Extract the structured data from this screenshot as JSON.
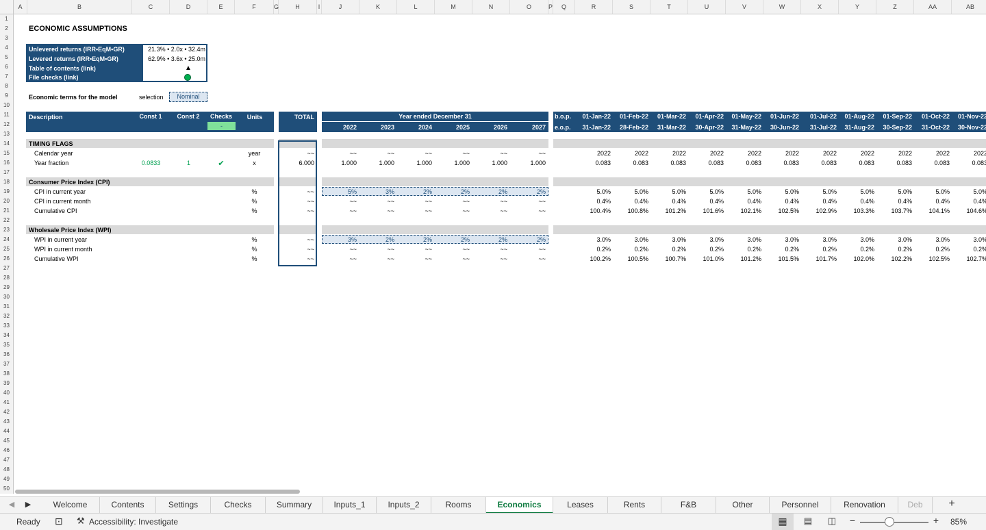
{
  "columns": [
    "A",
    "B",
    "C",
    "D",
    "E",
    "F",
    "G",
    "H",
    "I",
    "J",
    "K",
    "L",
    "M",
    "N",
    "O",
    "P",
    "Q",
    "R",
    "S",
    "T",
    "U",
    "V",
    "W",
    "X",
    "Y",
    "Z",
    "AA",
    "AB"
  ],
  "rows": [
    "1",
    "2",
    "3",
    "4",
    "5",
    "6",
    "7",
    "8",
    "9",
    "10",
    "11",
    "12",
    "13",
    "14",
    "15",
    "16",
    "17",
    "18",
    "19",
    "20",
    "21",
    "22",
    "23",
    "24",
    "25",
    "26",
    "27",
    "28",
    "29",
    "30",
    "31",
    "32",
    "33",
    "34",
    "35",
    "36",
    "37",
    "38",
    "39",
    "40",
    "41",
    "42",
    "43",
    "44",
    "45",
    "46",
    "47",
    "48",
    "49",
    "50"
  ],
  "sheet": {
    "title": "ECONOMIC ASSUMPTIONS",
    "summary": [
      {
        "label": "Unlevered returns (IRR•EqM•GR)",
        "value": "21.3% • 2.0x • 32.4m"
      },
      {
        "label": "Levered returns (IRR•EqM•GR)",
        "value": "62.9% • 3.6x • 25.0m"
      },
      {
        "label": "Table of contents (link)",
        "value": "▲"
      },
      {
        "label": "File checks (link)",
        "value": ""
      }
    ],
    "terms_label": "Economic terms for the model",
    "selection_label": "selection",
    "selection_value": "Nominal",
    "header": {
      "description": "Description",
      "const1": "Const 1",
      "const2": "Const 2",
      "checks": "Checks",
      "checks_value": "-",
      "units": "Units",
      "total": "TOTAL",
      "year_ended": "Year ended December 31",
      "years": [
        "2022",
        "2023",
        "2024",
        "2025",
        "2026",
        "2027"
      ],
      "bop": "b.o.p.",
      "eop": "e.o.p.",
      "month_start": [
        "01-Jan-22",
        "01-Feb-22",
        "01-Mar-22",
        "01-Apr-22",
        "01-May-22",
        "01-Jun-22",
        "01-Jul-22",
        "01-Aug-22",
        "01-Sep-22",
        "01-Oct-22",
        "01-Nov-22"
      ],
      "month_end": [
        "31-Jan-22",
        "28-Feb-22",
        "31-Mar-22",
        "30-Apr-22",
        "31-May-22",
        "30-Jun-22",
        "31-Jul-22",
        "31-Aug-22",
        "30-Sep-22",
        "31-Oct-22",
        "30-Nov-22"
      ]
    },
    "sections": {
      "timing": "TIMING FLAGS",
      "cpi": "Consumer Price Index (CPI)",
      "wpi": "Wholesale Price Index (WPI)"
    },
    "rows15": {
      "label": "Calendar year",
      "units": "year",
      "total": "~~",
      "annual": [
        "~~",
        "~~",
        "~~",
        "~~",
        "~~",
        "~~"
      ],
      "monthly": [
        "2022",
        "2022",
        "2022",
        "2022",
        "2022",
        "2022",
        "2022",
        "2022",
        "2022",
        "2022",
        "2022"
      ]
    },
    "rows16": {
      "label": "Year fraction",
      "const1": "0.0833",
      "const2": "1",
      "check": "✔",
      "units": "x",
      "total": "6.000",
      "annual": [
        "1.000",
        "1.000",
        "1.000",
        "1.000",
        "1.000",
        "1.000"
      ],
      "monthly": [
        "0.083",
        "0.083",
        "0.083",
        "0.083",
        "0.083",
        "0.083",
        "0.083",
        "0.083",
        "0.083",
        "0.083",
        "0.083"
      ]
    },
    "rows19": {
      "label": "CPI in current year",
      "units": "%",
      "total": "~~",
      "annual": [
        "5%",
        "3%",
        "2%",
        "2%",
        "2%",
        "2%"
      ],
      "monthly": [
        "5.0%",
        "5.0%",
        "5.0%",
        "5.0%",
        "5.0%",
        "5.0%",
        "5.0%",
        "5.0%",
        "5.0%",
        "5.0%",
        "5.0%"
      ]
    },
    "rows20": {
      "label": "CPI in current month",
      "units": "%",
      "total": "~~",
      "annual": [
        "~~",
        "~~",
        "~~",
        "~~",
        "~~",
        "~~"
      ],
      "monthly": [
        "0.4%",
        "0.4%",
        "0.4%",
        "0.4%",
        "0.4%",
        "0.4%",
        "0.4%",
        "0.4%",
        "0.4%",
        "0.4%",
        "0.4%"
      ]
    },
    "rows21": {
      "label": "Cumulative CPI",
      "units": "%",
      "total": "~~",
      "annual": [
        "~~",
        "~~",
        "~~",
        "~~",
        "~~",
        "~~"
      ],
      "monthly": [
        "100.4%",
        "100.8%",
        "101.2%",
        "101.6%",
        "102.1%",
        "102.5%",
        "102.9%",
        "103.3%",
        "103.7%",
        "104.1%",
        "104.6%"
      ]
    },
    "rows24": {
      "label": "WPI in current year",
      "units": "%",
      "total": "~~",
      "annual": [
        "3%",
        "2%",
        "2%",
        "2%",
        "2%",
        "2%"
      ],
      "monthly": [
        "3.0%",
        "3.0%",
        "3.0%",
        "3.0%",
        "3.0%",
        "3.0%",
        "3.0%",
        "3.0%",
        "3.0%",
        "3.0%",
        "3.0%"
      ]
    },
    "rows25": {
      "label": "WPI in current month",
      "units": "%",
      "total": "~~",
      "annual": [
        "~~",
        "~~",
        "~~",
        "~~",
        "~~",
        "~~"
      ],
      "monthly": [
        "0.2%",
        "0.2%",
        "0.2%",
        "0.2%",
        "0.2%",
        "0.2%",
        "0.2%",
        "0.2%",
        "0.2%",
        "0.2%",
        "0.2%"
      ]
    },
    "rows26": {
      "label": "Cumulative WPI",
      "units": "%",
      "total": "~~",
      "annual": [
        "~~",
        "~~",
        "~~",
        "~~",
        "~~",
        "~~"
      ],
      "monthly": [
        "100.2%",
        "100.5%",
        "100.7%",
        "101.0%",
        "101.2%",
        "101.5%",
        "101.7%",
        "102.0%",
        "102.2%",
        "102.5%",
        "102.7%"
      ]
    }
  },
  "tabs": [
    "Welcome",
    "Contents",
    "Settings",
    "Checks",
    "Summary",
    "Inputs_1",
    "Inputs_2",
    "Rooms",
    "Economics",
    "Leases",
    "Rents",
    "F&B",
    "Other",
    "Personnel",
    "Renovation",
    "Deb"
  ],
  "active_tab": "Economics",
  "status": {
    "ready": "Ready",
    "accessibility": "Accessibility: Investigate",
    "zoom": "85%"
  }
}
